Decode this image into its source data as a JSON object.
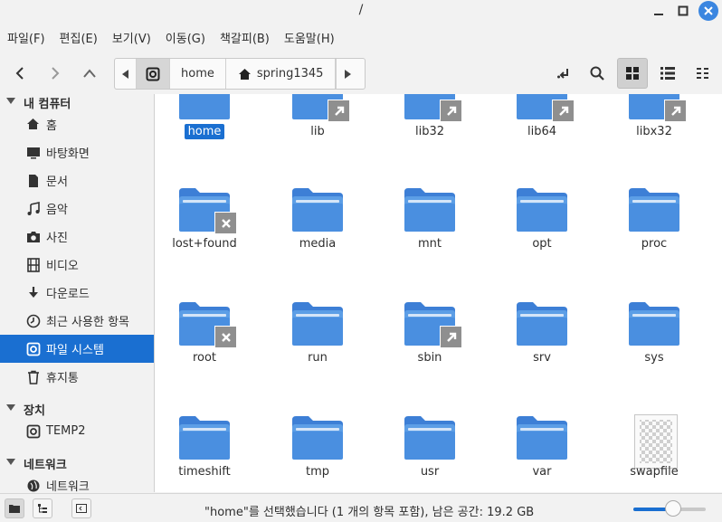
{
  "window": {
    "title": "/"
  },
  "menu": [
    "파일(F)",
    "편집(E)",
    "보기(V)",
    "이동(G)",
    "책갈피(B)",
    "도움말(H)"
  ],
  "path": {
    "segments": [
      "home",
      "spring1345"
    ]
  },
  "sidebar": {
    "sections": [
      {
        "label": "내 컴퓨터",
        "items": [
          {
            "label": "홈",
            "icon": "home-icon"
          },
          {
            "label": "바탕화면",
            "icon": "desktop-icon"
          },
          {
            "label": "문서",
            "icon": "document-icon"
          },
          {
            "label": "음악",
            "icon": "music-icon"
          },
          {
            "label": "사진",
            "icon": "camera-icon"
          },
          {
            "label": "비디오",
            "icon": "film-icon"
          },
          {
            "label": "다운로드",
            "icon": "download-icon"
          },
          {
            "label": "최근 사용한 항목",
            "icon": "clock-icon"
          },
          {
            "label": "파일 시스템",
            "icon": "drive-icon",
            "active": true
          },
          {
            "label": "휴지통",
            "icon": "trash-icon"
          }
        ]
      },
      {
        "label": "장치",
        "items": [
          {
            "label": "TEMP2",
            "icon": "drive-icon"
          }
        ]
      },
      {
        "label": "네트워크",
        "items": [
          {
            "label": "네트워크",
            "icon": "network-icon"
          }
        ]
      }
    ]
  },
  "files": [
    {
      "name": "home",
      "emblem": "",
      "selected": true
    },
    {
      "name": "lib",
      "emblem": "link"
    },
    {
      "name": "lib32",
      "emblem": "link"
    },
    {
      "name": "lib64",
      "emblem": "link"
    },
    {
      "name": "libx32",
      "emblem": "link"
    },
    {
      "name": "lost+found",
      "emblem": "noaccess"
    },
    {
      "name": "media",
      "emblem": ""
    },
    {
      "name": "mnt",
      "emblem": ""
    },
    {
      "name": "opt",
      "emblem": ""
    },
    {
      "name": "proc",
      "emblem": ""
    },
    {
      "name": "root",
      "emblem": "noaccess"
    },
    {
      "name": "run",
      "emblem": ""
    },
    {
      "name": "sbin",
      "emblem": "link"
    },
    {
      "name": "srv",
      "emblem": ""
    },
    {
      "name": "sys",
      "emblem": ""
    },
    {
      "name": "timeshift",
      "emblem": ""
    },
    {
      "name": "tmp",
      "emblem": ""
    },
    {
      "name": "usr",
      "emblem": ""
    },
    {
      "name": "var",
      "emblem": ""
    },
    {
      "name": "swapfile",
      "emblem": "",
      "type": "file"
    }
  ],
  "status": {
    "text": "\"home\"를 선택했습니다 (1 개의 항목 포함), 남은 공간: 19.2 GB",
    "zoom": 0.55
  },
  "colors": {
    "accent": "#1a6fd1",
    "folder": "#4a8fe0",
    "folder_tab": "#5c9ee6"
  }
}
